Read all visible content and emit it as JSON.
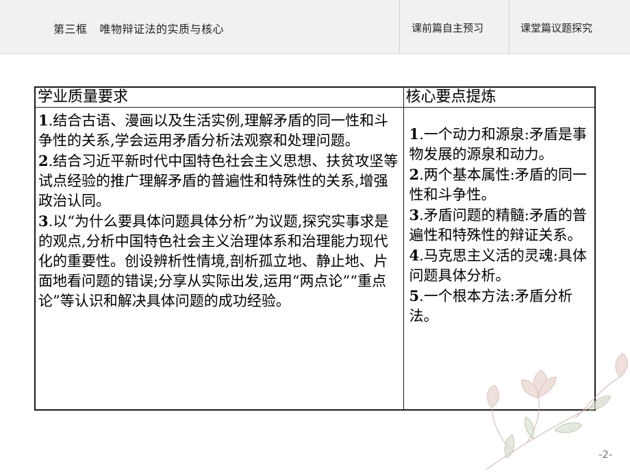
{
  "header": {
    "section": "第三框",
    "title": "唯物辩证法的实质与核心",
    "tabs": [
      {
        "label": "课前篇自主预习"
      },
      {
        "label": "课堂篇议题探究"
      }
    ]
  },
  "table": {
    "headers": [
      "学业质量要求",
      "核心要点提炼"
    ],
    "left_items": [
      {
        "num": "1",
        "text": ".结合古语、漫画以及生活实例,理解矛盾的同一性和斗争性的关系,学会运用矛盾分析法观察和处理问题。"
      },
      {
        "num": "2",
        "text": ".结合习近平新时代中国特色社会主义思想、扶贫攻坚等试点经验的推广理解矛盾的普遍性和特殊性的关系,增强政治认同。"
      },
      {
        "num": "3",
        "text": ".以“为什么要具体问题具体分析”为议题,探究实事求是的观点,分析中国特色社会主义治理体系和治理能力现代化的重要性。创设辨析性情境,剖析孤立地、静止地、片面地看问题的错误;分享从实际出发,运用“两点论”“重点论”等认识和解决具体问题的成功经验。"
      }
    ],
    "right_items": [
      {
        "num": "1",
        "text": ".一个动力和源泉:矛盾是事物发展的源泉和动力。"
      },
      {
        "num": "2",
        "text": ".两个基本属性:矛盾的同一性和斗争性。"
      },
      {
        "num": "3",
        "text": ".矛盾问题的精髓:矛盾的普遍性和特殊性的辩证关系。"
      },
      {
        "num": "4",
        "text": ".马克思主义活的灵魂:具体问题具体分析。"
      },
      {
        "num": "5",
        "text": ".一个根本方法:矛盾分析法。"
      }
    ]
  },
  "page_number": "-2-",
  "colors": {
    "header_bg": "#f1f1f1",
    "border": "#1a1a1a",
    "text": "#000000",
    "page_number": "#777777"
  }
}
